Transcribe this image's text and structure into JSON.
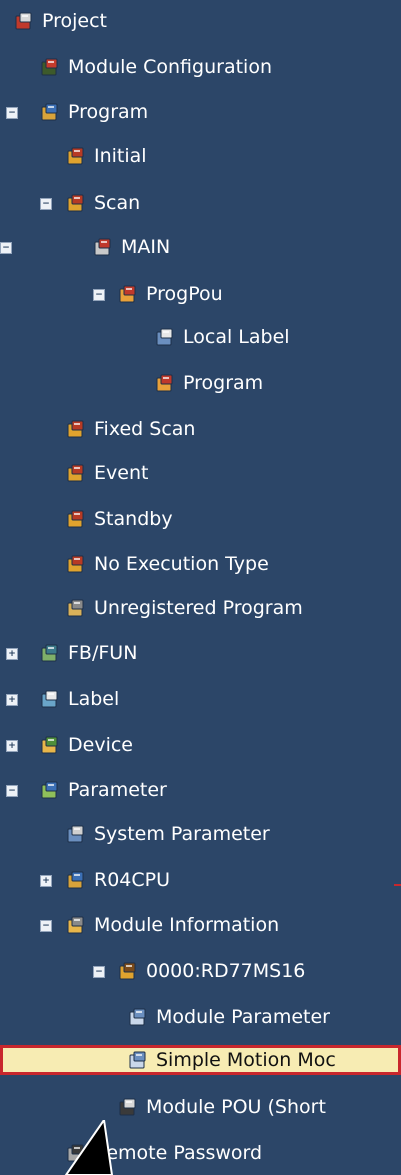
{
  "tree": {
    "items": [
      {
        "label": "Project",
        "toggle": "",
        "icon": "project-icon",
        "colors": [
          "#c0392b",
          "#d8d8d8"
        ]
      },
      {
        "label": "Module Configuration",
        "toggle": "",
        "icon": "module-configuration-icon",
        "colors": [
          "#3d5a2b",
          "#c53b2c"
        ]
      },
      {
        "label": "Program",
        "toggle": "−",
        "icon": "program-folder-icon",
        "colors": [
          "#d8a33a",
          "#3b6fb5"
        ]
      },
      {
        "label": "Initial",
        "toggle": "",
        "icon": "program-type-icon",
        "colors": [
          "#e0a32e",
          "#b73a24"
        ]
      },
      {
        "label": "Scan",
        "toggle": "−",
        "icon": "program-type-icon",
        "colors": [
          "#e0a32e",
          "#b73a24"
        ]
      },
      {
        "label": "MAIN",
        "toggle": "−",
        "icon": "program-file-icon",
        "colors": [
          "#c9c9c9",
          "#c0392b"
        ]
      },
      {
        "label": "ProgPou",
        "toggle": "−",
        "icon": "pou-icon",
        "colors": [
          "#e9a13a",
          "#c0392b"
        ]
      },
      {
        "label": "Local Label",
        "toggle": "",
        "icon": "local-label-icon",
        "colors": [
          "#6b8fbf",
          "#e8e8e8"
        ]
      },
      {
        "label": "Program",
        "toggle": "",
        "icon": "program-body-icon",
        "colors": [
          "#e9a13a",
          "#c0392b"
        ]
      },
      {
        "label": "Fixed Scan",
        "toggle": "",
        "icon": "program-type-icon",
        "colors": [
          "#e0a32e",
          "#b73a24"
        ]
      },
      {
        "label": "Event",
        "toggle": "",
        "icon": "program-type-icon",
        "colors": [
          "#e0a32e",
          "#b73a24"
        ]
      },
      {
        "label": "Standby",
        "toggle": "",
        "icon": "program-type-icon",
        "colors": [
          "#e0a32e",
          "#b73a24"
        ]
      },
      {
        "label": "No Execution Type",
        "toggle": "",
        "icon": "program-type-icon",
        "colors": [
          "#e0a32e",
          "#b73a24"
        ]
      },
      {
        "label": "Unregistered Program",
        "toggle": "",
        "icon": "unregistered-program-icon",
        "colors": [
          "#d9b15a",
          "#8a8a8a"
        ]
      },
      {
        "label": "FB/FUN",
        "toggle": "+",
        "icon": "fb-fun-folder-icon",
        "colors": [
          "#7fb069",
          "#3c7a8a"
        ]
      },
      {
        "label": "Label",
        "toggle": "+",
        "icon": "label-folder-icon",
        "colors": [
          "#6aa5c9",
          "#e8e8e8"
        ]
      },
      {
        "label": "Device",
        "toggle": "+",
        "icon": "device-folder-icon",
        "colors": [
          "#e8b64a",
          "#4f8f3a"
        ]
      },
      {
        "label": "Parameter",
        "toggle": "−",
        "icon": "parameter-folder-icon",
        "colors": [
          "#8fbf5a",
          "#3b6fb5"
        ]
      },
      {
        "label": "System Parameter",
        "toggle": "",
        "icon": "system-parameter-icon",
        "colors": [
          "#6b8fbf",
          "#d0d0d0"
        ]
      },
      {
        "label": "R04CPU",
        "toggle": "+",
        "icon": "cpu-icon",
        "colors": [
          "#d8a33a",
          "#3b6fb5"
        ]
      },
      {
        "label": "Module Information",
        "toggle": "−",
        "icon": "module-information-icon",
        "colors": [
          "#e9b64a",
          "#8a8a8a"
        ]
      },
      {
        "label": "0000:RD77MS16",
        "toggle": "−",
        "icon": "module-icon",
        "colors": [
          "#e0a32e",
          "#7a4a1a"
        ]
      },
      {
        "label": "Module Parameter",
        "toggle": "",
        "icon": "module-parameter-icon",
        "colors": [
          "#c9d7ea",
          "#6b8fbf"
        ]
      },
      {
        "label": "Simple Motion Moc",
        "toggle": "",
        "icon": "simple-motion-icon",
        "colors": [
          "#c9d7ea",
          "#6b8fbf"
        ],
        "selected": true
      },
      {
        "label": "Module POU (Short",
        "toggle": "",
        "icon": "module-pou-icon",
        "colors": [
          "#3a3a3a",
          "#d8d8d8"
        ]
      },
      {
        "label": "Remote Password",
        "toggle": "",
        "icon": "remote-password-icon",
        "colors": [
          "#a8a8a8",
          "#3a3a3a"
        ]
      }
    ]
  },
  "accent": "#c8272d",
  "selection_bg": "#f7ecb3",
  "panel_bg": "#2c4668"
}
